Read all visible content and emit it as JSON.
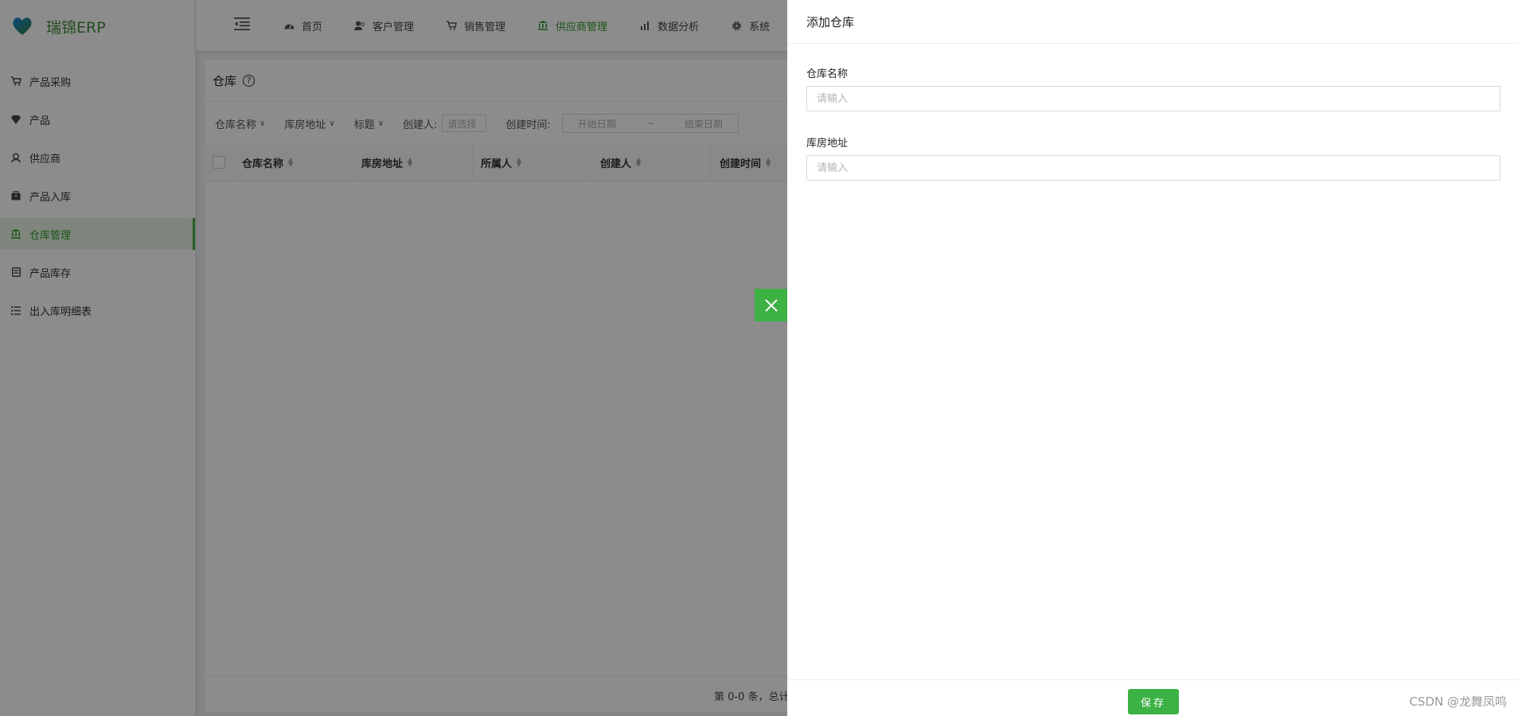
{
  "brand": {
    "name": "瑞锦ERP"
  },
  "sidebar": {
    "items": [
      {
        "label": "产品采购",
        "icon": "cart-icon"
      },
      {
        "label": "产品",
        "icon": "gem-icon"
      },
      {
        "label": "供应商",
        "icon": "contact-icon"
      },
      {
        "label": "产品入库",
        "icon": "box-icon"
      },
      {
        "label": "仓库管理",
        "icon": "bank-icon",
        "active": true
      },
      {
        "label": "产品库存",
        "icon": "stack-icon"
      },
      {
        "label": "出入库明细表",
        "icon": "list-icon"
      }
    ]
  },
  "topnav": {
    "items": [
      {
        "label": "首页",
        "icon": "dashboard-icon"
      },
      {
        "label": "客户管理",
        "icon": "users-icon"
      },
      {
        "label": "销售管理",
        "icon": "cart-icon"
      },
      {
        "label": "供应商管理",
        "icon": "bank-icon",
        "active": true
      },
      {
        "label": "数据分析",
        "icon": "chart-icon"
      },
      {
        "label": "系统",
        "icon": "gear-icon"
      }
    ]
  },
  "page": {
    "title": "仓库",
    "filters": {
      "warehouse_name": "仓库名称",
      "address": "库房地址",
      "title": "标题",
      "creator_label": "创建人:",
      "creator_placeholder": "请选择",
      "created_time_label": "创建时间:",
      "start_date": "开始日期",
      "range_sep": "~",
      "end_date": "结束日期"
    },
    "columns": [
      "仓库名称",
      "库房地址",
      "所属人",
      "创建人",
      "创建时间"
    ],
    "pager_text": "第 0-0 条，总计"
  },
  "drawer": {
    "title": "添加仓库",
    "fields": [
      {
        "label": "仓库名称",
        "placeholder": "请输入",
        "value": ""
      },
      {
        "label": "库房地址",
        "placeholder": "请输入",
        "value": ""
      }
    ],
    "save_label": "保存"
  },
  "watermark": "CSDN @龙舞凤鸣",
  "colors": {
    "primary": "#3cb144",
    "active_text": "#2e9b2a"
  }
}
